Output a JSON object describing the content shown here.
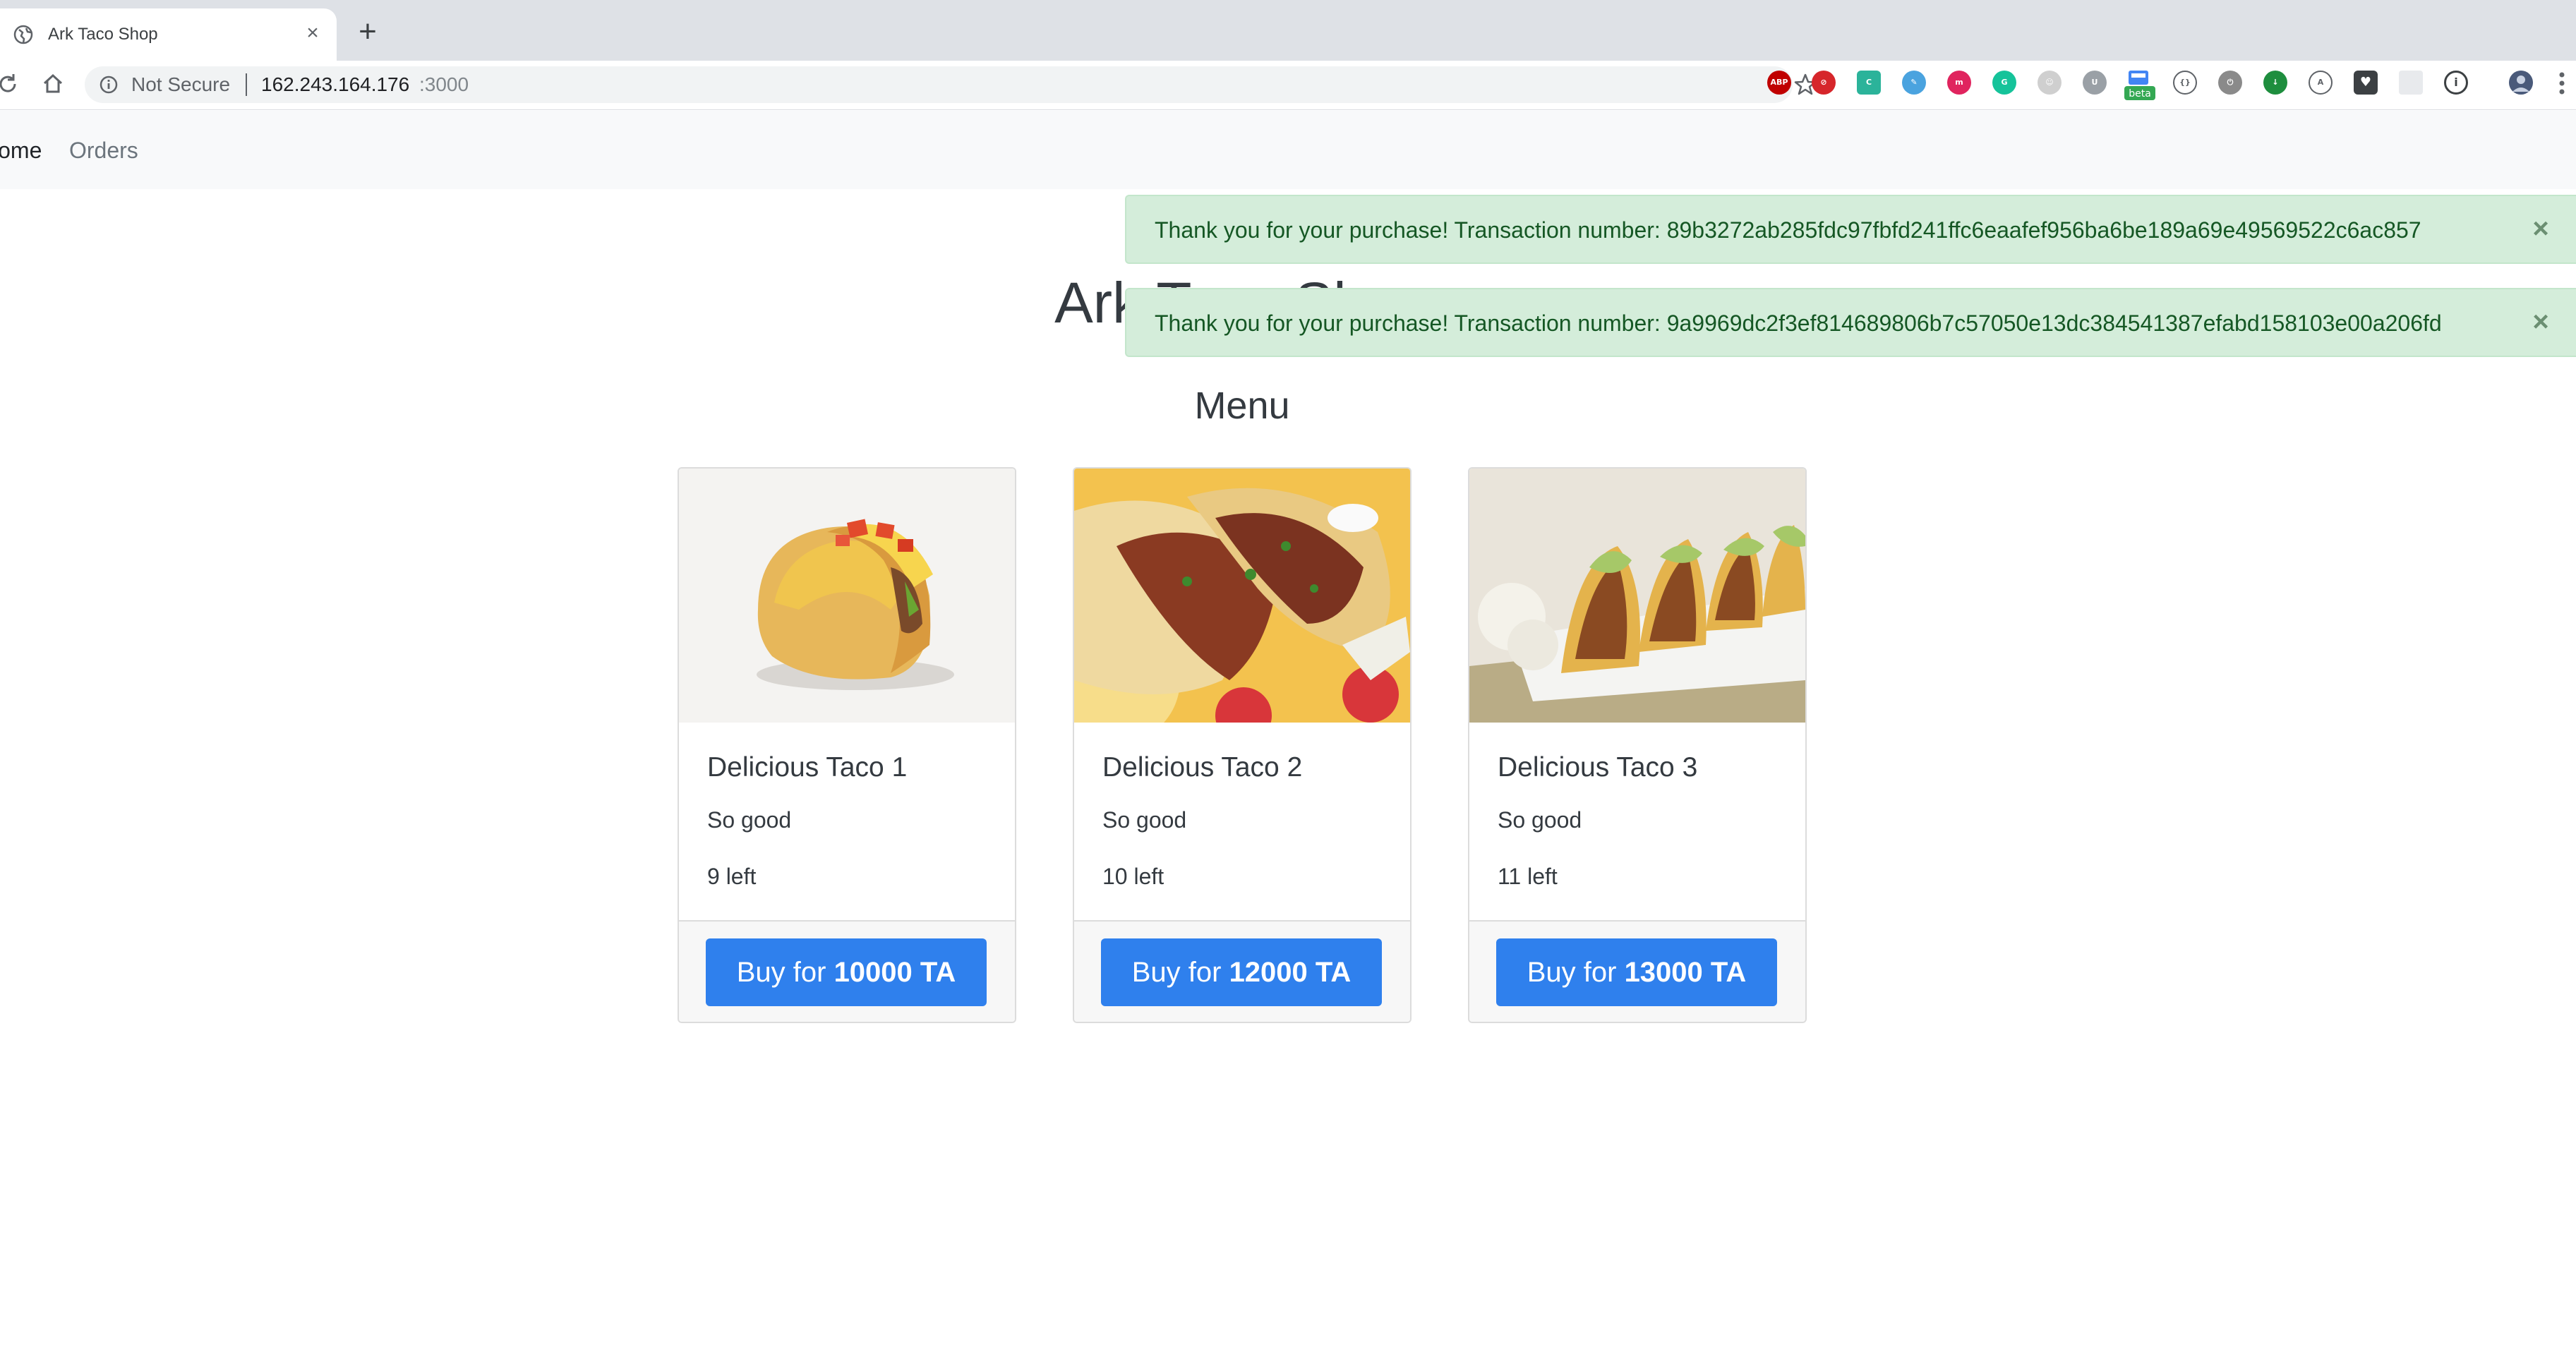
{
  "browser": {
    "tab_title": "Ark Taco Shop",
    "tab_close": "×",
    "new_tab": "+",
    "security_label": "Not Secure",
    "url_host": "162.243.164.176",
    "url_port": ":3000",
    "extensions": [
      {
        "icon": "adblock-icon",
        "label": "ABP",
        "color": "#c00000"
      },
      {
        "icon": "block-icon",
        "label": "⊘",
        "color": "#d6262b"
      },
      {
        "icon": "c-icon",
        "label": "C",
        "color": "#2bb39a"
      },
      {
        "icon": "feather-icon",
        "label": "✎",
        "color": "#4aa3df"
      },
      {
        "icon": "m-icon",
        "label": "m",
        "color": "#e0245e"
      },
      {
        "icon": "grammarly-icon",
        "label": "G",
        "color": "#15c39a"
      },
      {
        "icon": "cat-icon",
        "label": "☺",
        "color": "#cfcfcf"
      },
      {
        "icon": "u-icon",
        "label": "U",
        "color": "#9aa0a6"
      },
      {
        "icon": "code-icon",
        "label": "{}",
        "color": "#5f6368"
      },
      {
        "icon": "power-icon",
        "label": "⏻",
        "color": "#8a8a8a"
      },
      {
        "icon": "download-icon",
        "label": "↓",
        "color": "#1e8e3e"
      },
      {
        "icon": "a-icon",
        "label": "A",
        "color": "#5f6368"
      },
      {
        "icon": "pocket-icon",
        "label": "♥",
        "color": "#3c4043"
      },
      {
        "icon": "blank-icon",
        "label": "",
        "color": "#e8eaed"
      },
      {
        "icon": "info-icon",
        "label": "i",
        "color": "#3c4043"
      }
    ],
    "beta_label": "beta"
  },
  "nav": {
    "home": "Home",
    "orders": "Orders"
  },
  "alerts": [
    {
      "text": "Thank you for your purchase! Transaction number: 89b3272ab285fdc97fbfd241ffc6eaafef956ba6be189a69e49569522c6ac857",
      "close": "×"
    },
    {
      "text": "Thank you for your purchase! Transaction number: 9a9969dc2f3ef814689806b7c57050e13dc384541387efabd158103e00a206fd",
      "close": "×"
    }
  ],
  "page": {
    "title": "Ark Taco Shop",
    "menu_heading": "Menu"
  },
  "products": [
    {
      "name": "Delicious Taco 1",
      "description": "So good",
      "stock": "9 left",
      "buy_prefix": "Buy for ",
      "price": "10000 TA"
    },
    {
      "name": "Delicious Taco 2",
      "description": "So good",
      "stock": "10 left",
      "buy_prefix": "Buy for ",
      "price": "12000 TA"
    },
    {
      "name": "Delicious Taco 3",
      "description": "So good",
      "stock": "11 left",
      "buy_prefix": "Buy for ",
      "price": "13000 TA"
    }
  ],
  "colors": {
    "primary": "#2f80ed",
    "alert_bg": "#d4edda",
    "alert_text": "#155724",
    "navbar_bg": "#f8f9fa"
  }
}
